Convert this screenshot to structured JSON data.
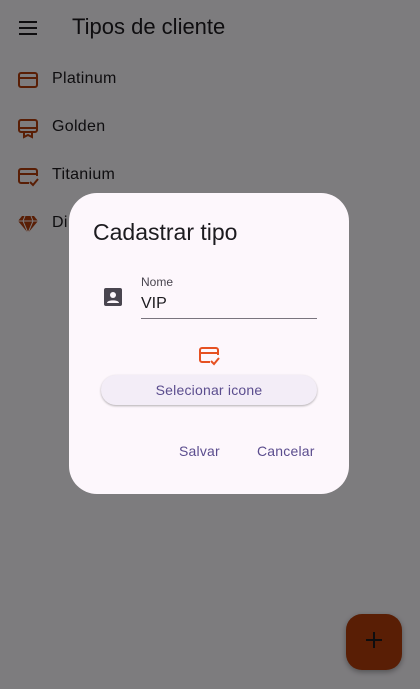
{
  "appbar": {
    "title": "Tipos de cliente",
    "menu_icon": "menu-icon"
  },
  "list": [
    {
      "label": "Platinum",
      "icon": "credit-card-icon"
    },
    {
      "label": "Golden",
      "icon": "card-membership-icon"
    },
    {
      "label": "Titanium",
      "icon": "credit-score-icon"
    },
    {
      "label": "Di",
      "icon": "diamond-icon"
    }
  ],
  "colors": {
    "accent": "#b33d0b",
    "scrim": "rgba(0,0,0,0.5)",
    "dialog_bg": "#fdf7fc",
    "action_text": "#5b4d8e",
    "picked_icon": "#e65122"
  },
  "dialog": {
    "title": "Cadastrar tipo",
    "field": {
      "label": "Nome",
      "value": "VIP",
      "icon": "contact-card-icon"
    },
    "picked_icon": "credit-score-icon",
    "select_button": "Selecionar icone",
    "actions": {
      "save": "Salvar",
      "cancel": "Cancelar"
    }
  },
  "fab": {
    "icon": "plus-icon"
  }
}
